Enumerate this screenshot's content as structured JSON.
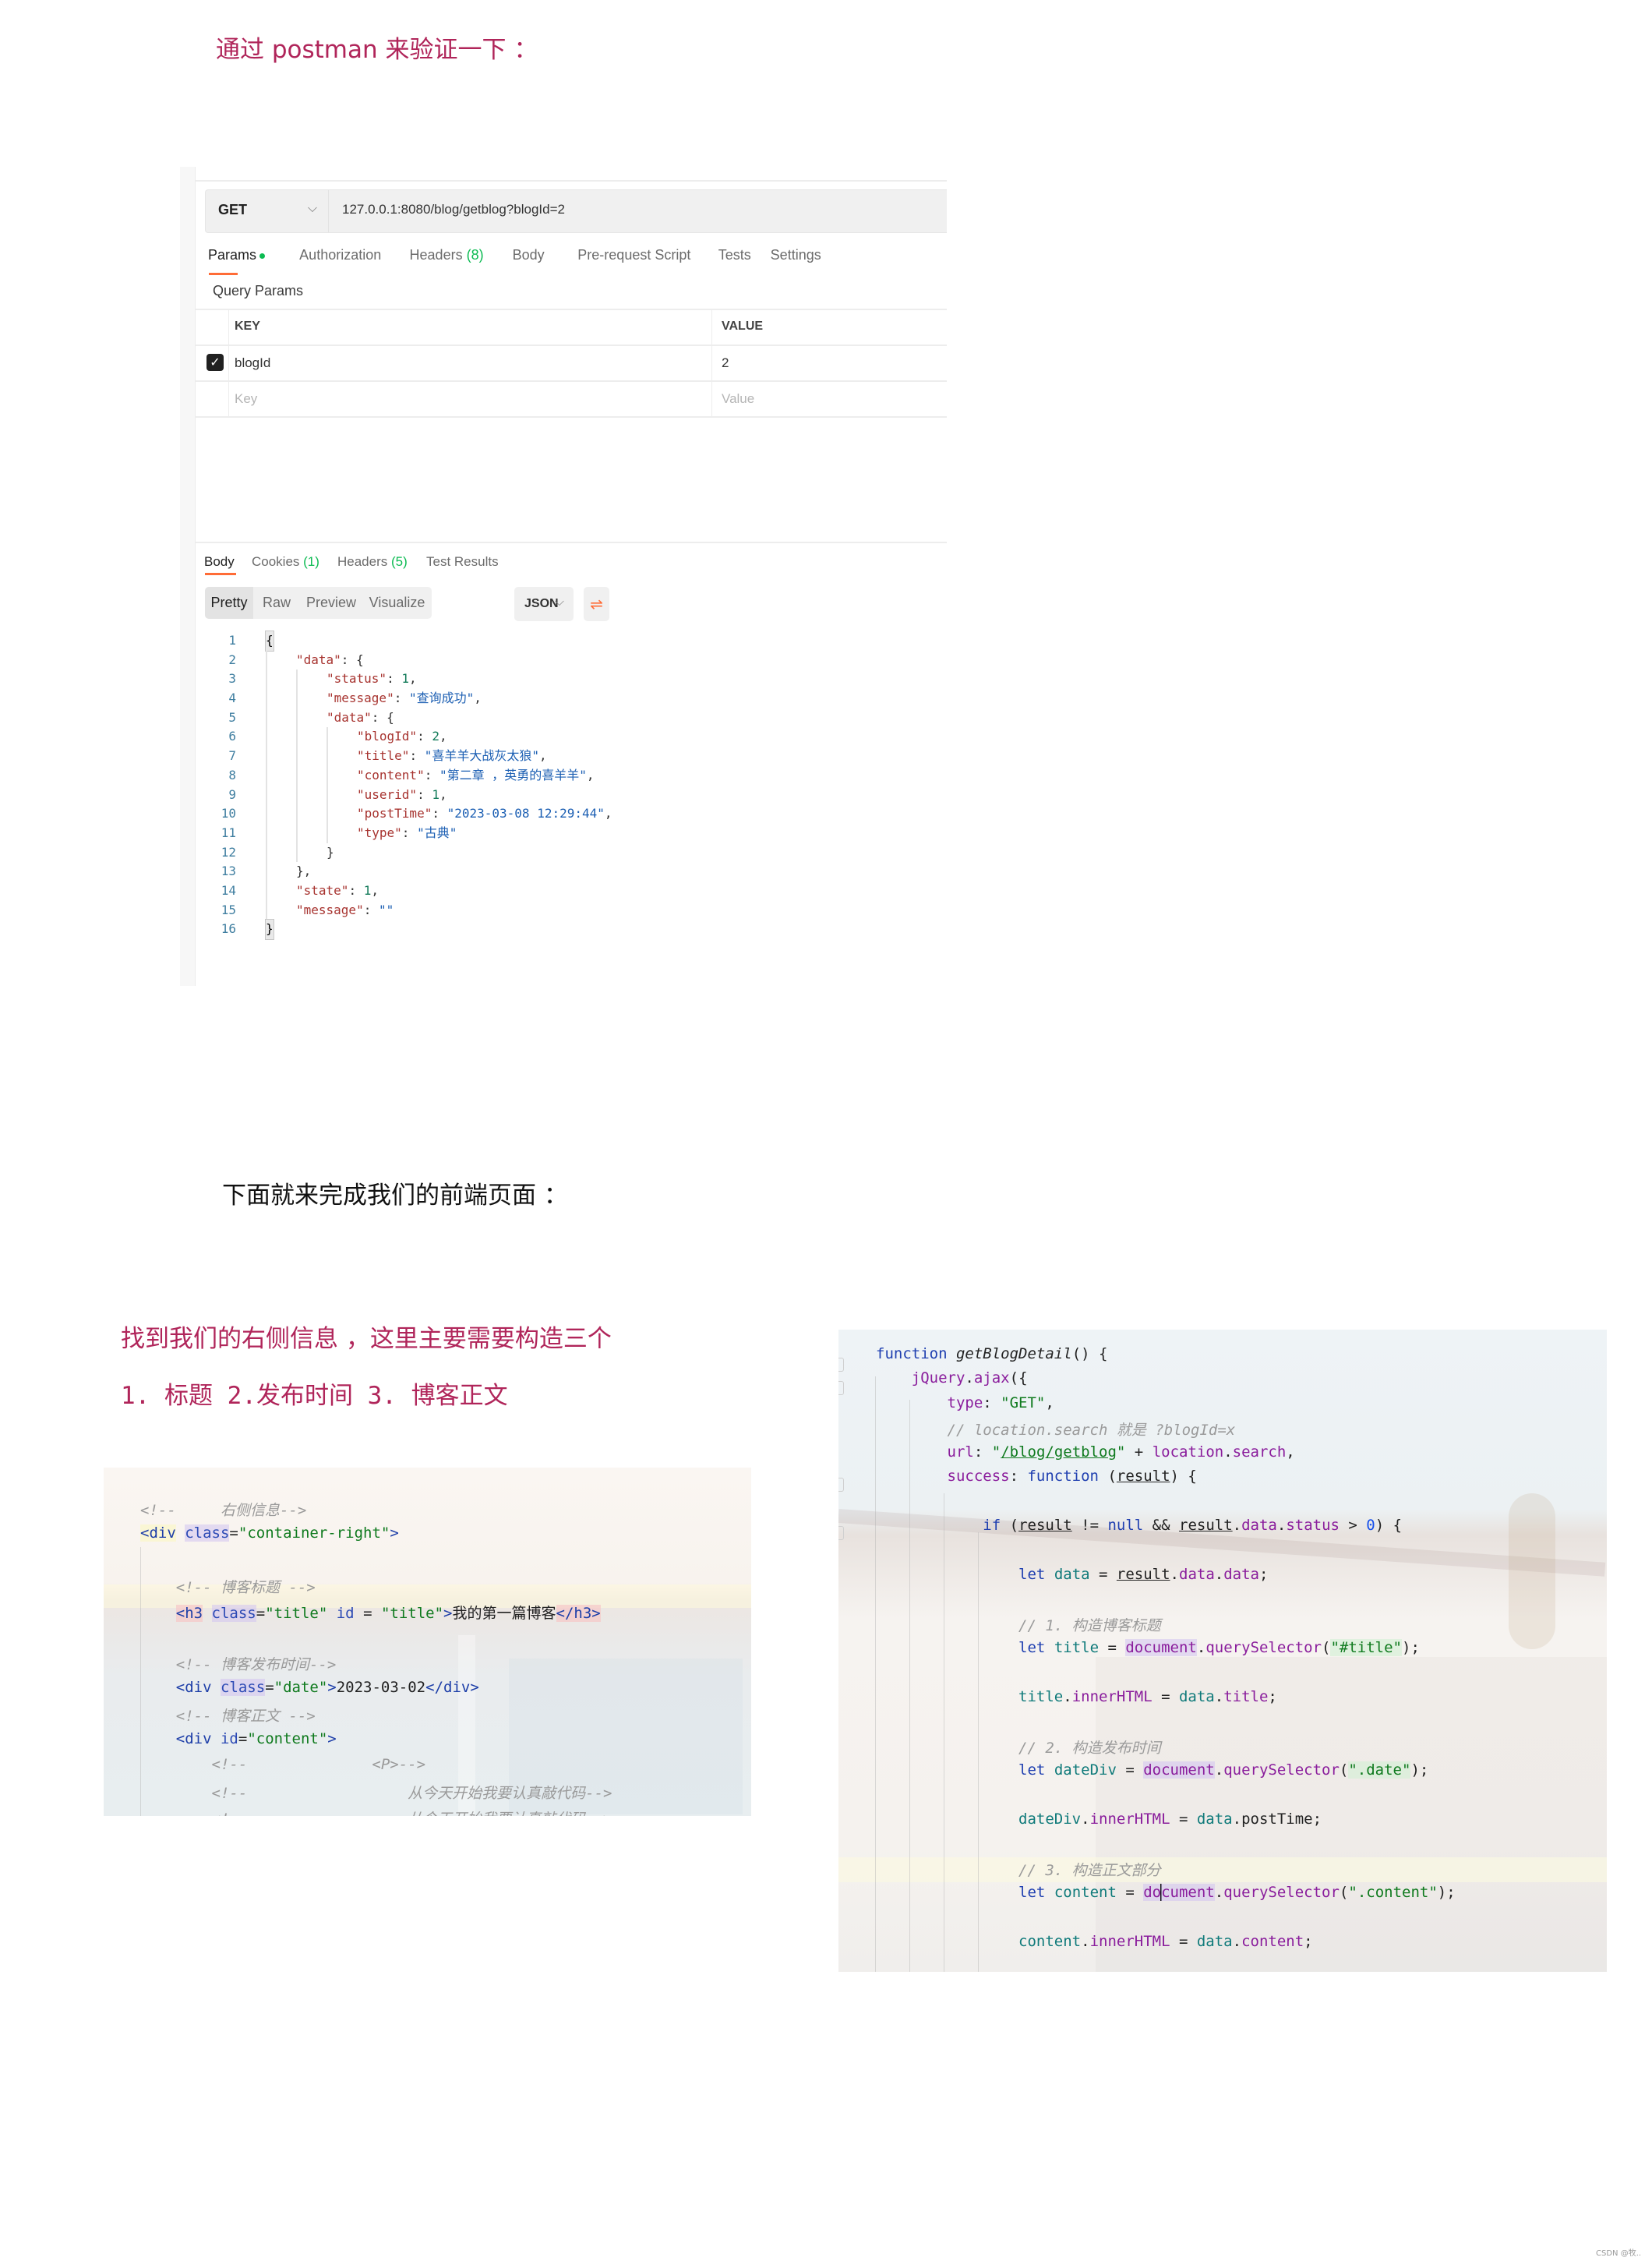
{
  "intro": {
    "verify_text": "通过 postman 来验证一下 ：",
    "frontend_text": "下面就来完成我们的前端页面 ：",
    "right_info_text": "找到我们的右侧信息 ，这里主要需要构造三个",
    "items_text": "1. 标题 2.发布时间 3. 博客正文"
  },
  "postman": {
    "method": "GET",
    "url": "127.0.0.1:8080/blog/getblog?blogId=2",
    "request_tabs": [
      {
        "label": "Params",
        "count": "",
        "active": true,
        "dot": true
      },
      {
        "label": "Authorization",
        "count": ""
      },
      {
        "label": "Headers ",
        "count": "(8)"
      },
      {
        "label": "Body",
        "count": ""
      },
      {
        "label": "Pre-request Script",
        "count": ""
      },
      {
        "label": "Tests",
        "count": ""
      },
      {
        "label": "Settings",
        "count": ""
      }
    ],
    "query_params_title": "Query Params",
    "params_table": {
      "headers": [
        "KEY",
        "VALUE"
      ],
      "rows": [
        {
          "checked": true,
          "key": "blogId",
          "value": "2"
        }
      ],
      "placeholder": {
        "key": "Key",
        "value": "Value"
      }
    },
    "response_tabs": [
      {
        "label": "Body",
        "count": "",
        "active": true
      },
      {
        "label": "Cookies ",
        "count": "(1)"
      },
      {
        "label": "Headers ",
        "count": "(5)"
      },
      {
        "label": "Test Results",
        "count": ""
      }
    ],
    "view_modes": [
      "Pretty",
      "Raw",
      "Preview",
      "Visualize"
    ],
    "active_view": "Pretty",
    "format": "JSON",
    "response_lines": [
      {
        "n": "1",
        "indent": 0,
        "parts": [
          [
            "brk",
            "{"
          ]
        ]
      },
      {
        "n": "2",
        "indent": 1,
        "parts": [
          [
            "k",
            "\"data\""
          ],
          [
            "p",
            ": {"
          ]
        ]
      },
      {
        "n": "3",
        "indent": 2,
        "parts": [
          [
            "k",
            "\"status\""
          ],
          [
            "p",
            ": "
          ],
          [
            "n",
            "1"
          ],
          [
            "p",
            ","
          ]
        ]
      },
      {
        "n": "4",
        "indent": 2,
        "parts": [
          [
            "k",
            "\"message\""
          ],
          [
            "p",
            ": "
          ],
          [
            "s",
            "\"查询成功\""
          ],
          [
            "p",
            ","
          ]
        ]
      },
      {
        "n": "5",
        "indent": 2,
        "parts": [
          [
            "k",
            "\"data\""
          ],
          [
            "p",
            ": {"
          ]
        ]
      },
      {
        "n": "6",
        "indent": 3,
        "parts": [
          [
            "k",
            "\"blogId\""
          ],
          [
            "p",
            ": "
          ],
          [
            "n",
            "2"
          ],
          [
            "p",
            ","
          ]
        ]
      },
      {
        "n": "7",
        "indent": 3,
        "parts": [
          [
            "k",
            "\"title\""
          ],
          [
            "p",
            ": "
          ],
          [
            "s",
            "\"喜羊羊大战灰太狼\""
          ],
          [
            "p",
            ","
          ]
        ]
      },
      {
        "n": "8",
        "indent": 3,
        "parts": [
          [
            "k",
            "\"content\""
          ],
          [
            "p",
            ": "
          ],
          [
            "s",
            "\"第二章 ，英勇的喜羊羊\""
          ],
          [
            "p",
            ","
          ]
        ]
      },
      {
        "n": "9",
        "indent": 3,
        "parts": [
          [
            "k",
            "\"userid\""
          ],
          [
            "p",
            ": "
          ],
          [
            "n",
            "1"
          ],
          [
            "p",
            ","
          ]
        ]
      },
      {
        "n": "10",
        "indent": 3,
        "parts": [
          [
            "k",
            "\"postTime\""
          ],
          [
            "p",
            ": "
          ],
          [
            "s",
            "\"2023-03-08 12:29:44\""
          ],
          [
            "p",
            ","
          ]
        ]
      },
      {
        "n": "11",
        "indent": 3,
        "parts": [
          [
            "k",
            "\"type\""
          ],
          [
            "p",
            ": "
          ],
          [
            "s",
            "\"古典\""
          ]
        ]
      },
      {
        "n": "12",
        "indent": 2,
        "parts": [
          [
            "p",
            "}"
          ]
        ]
      },
      {
        "n": "13",
        "indent": 1,
        "parts": [
          [
            "p",
            "},"
          ]
        ]
      },
      {
        "n": "14",
        "indent": 1,
        "parts": [
          [
            "k",
            "\"state\""
          ],
          [
            "p",
            ": "
          ],
          [
            "n",
            "1"
          ],
          [
            "p",
            ","
          ]
        ]
      },
      {
        "n": "15",
        "indent": 1,
        "parts": [
          [
            "k",
            "\"message\""
          ],
          [
            "p",
            ": "
          ],
          [
            "s",
            "\"\""
          ]
        ]
      },
      {
        "n": "16",
        "indent": 0,
        "parts": [
          [
            "brk",
            "}"
          ]
        ]
      }
    ]
  },
  "html_snippet": {
    "lines": [
      [
        [
          "t-cm",
          "<!--     右侧信息-->"
        ]
      ],
      [
        [
          "t-tag hl-yellow",
          "<div"
        ],
        [
          "t-plain",
          " "
        ],
        [
          "t-attr hl-purple",
          "class"
        ],
        [
          "t-plain",
          "="
        ],
        [
          "t-str",
          "\"container-right\""
        ],
        [
          "t-tag",
          ">"
        ]
      ],
      [],
      [
        [
          "t-cm",
          "    <!-- 博客标题 -->"
        ]
      ],
      [
        [
          "t-plain",
          "    "
        ],
        [
          "t-tag hl-red",
          "<h3"
        ],
        [
          "t-plain",
          " "
        ],
        [
          "t-attr hl-purple",
          "class"
        ],
        [
          "t-plain",
          "="
        ],
        [
          "t-str",
          "\"title\""
        ],
        [
          "t-plain",
          " "
        ],
        [
          "t-attr",
          "id"
        ],
        [
          "t-plain",
          " = "
        ],
        [
          "t-str",
          "\"title\""
        ],
        [
          "t-tag",
          ">"
        ],
        [
          "t-plain",
          "我的第一篇博客"
        ],
        [
          "t-tag hl-red",
          "</h3>"
        ]
      ],
      [],
      [
        [
          "t-cm",
          "    <!-- 博客发布时间-->"
        ]
      ],
      [
        [
          "t-plain",
          "    "
        ],
        [
          "t-tag",
          "<div"
        ],
        [
          "t-plain",
          " "
        ],
        [
          "t-attr hl-purple",
          "class"
        ],
        [
          "t-plain",
          "="
        ],
        [
          "t-str",
          "\"date\""
        ],
        [
          "t-tag",
          ">"
        ],
        [
          "t-plain",
          "2023-03-02"
        ],
        [
          "t-tag",
          "</div>"
        ]
      ],
      [
        [
          "t-cm",
          "    <!-- 博客正文 -->"
        ]
      ],
      [
        [
          "t-plain",
          "    "
        ],
        [
          "t-tag",
          "<div"
        ],
        [
          "t-plain",
          " "
        ],
        [
          "t-attr",
          "id"
        ],
        [
          "t-plain",
          "="
        ],
        [
          "t-str",
          "\"content\""
        ],
        [
          "t-tag",
          ">"
        ]
      ],
      [
        [
          "t-cm",
          "        <!--              <P>-->"
        ]
      ],
      [
        [
          "t-cm",
          "        <!--                  从今天开始我要认真敲代码-->"
        ]
      ],
      [
        [
          "t-cm",
          "        <!--                  从今天开始我要认真敲代码-->"
        ]
      ]
    ]
  },
  "js_snippet": {
    "lines": [
      [
        [
          "t-kw",
          "function"
        ],
        [
          "t-plain",
          " "
        ],
        [
          "t-fn",
          "getBlogDetail"
        ],
        [
          "t-plain",
          "() {"
        ]
      ],
      [
        [
          "t-plain",
          "    "
        ],
        [
          "t-mem",
          "jQuery"
        ],
        [
          "t-plain",
          "."
        ],
        [
          "t-mem",
          "ajax"
        ],
        [
          "t-plain",
          "({"
        ]
      ],
      [
        [
          "t-plain",
          "        "
        ],
        [
          "t-mem",
          "type"
        ],
        [
          "t-plain",
          ": "
        ],
        [
          "t-str",
          "\"GET\""
        ],
        [
          "t-plain",
          ","
        ]
      ],
      [
        [
          "t-plain",
          "        "
        ],
        [
          "t-cm",
          "// location.search 就是 ?blogId=x"
        ]
      ],
      [
        [
          "t-plain",
          "        "
        ],
        [
          "t-mem",
          "url"
        ],
        [
          "t-plain",
          ": "
        ],
        [
          "t-str",
          "\""
        ],
        [
          "t-str t-ul",
          "/blog/getblog"
        ],
        [
          "t-str",
          "\""
        ],
        [
          "t-plain",
          " + "
        ],
        [
          "t-mem",
          "location"
        ],
        [
          "t-plain",
          "."
        ],
        [
          "t-mem",
          "search"
        ],
        [
          "t-plain",
          ","
        ]
      ],
      [
        [
          "t-plain",
          "        "
        ],
        [
          "t-mem",
          "success"
        ],
        [
          "t-plain",
          ": "
        ],
        [
          "t-kw",
          "function"
        ],
        [
          "t-plain",
          " ("
        ],
        [
          "t-plain t-ul",
          "result"
        ],
        [
          "t-plain",
          ") {"
        ]
      ],
      [],
      [
        [
          "t-plain",
          "            "
        ],
        [
          "t-kw",
          "if"
        ],
        [
          "t-plain",
          " ("
        ],
        [
          "t-plain t-ul",
          "result"
        ],
        [
          "t-plain",
          " != "
        ],
        [
          "t-kw",
          "null"
        ],
        [
          "t-plain",
          " && "
        ],
        [
          "t-plain t-ul",
          "result"
        ],
        [
          "t-plain",
          "."
        ],
        [
          "t-mem",
          "data"
        ],
        [
          "t-plain",
          "."
        ],
        [
          "t-mem",
          "status"
        ],
        [
          "t-plain",
          " > "
        ],
        [
          "t-num",
          "0"
        ],
        [
          "t-plain",
          ") {"
        ]
      ],
      [],
      [
        [
          "t-plain",
          "                "
        ],
        [
          "t-kw",
          "let"
        ],
        [
          "t-plain",
          " "
        ],
        [
          "t-var",
          "data"
        ],
        [
          "t-plain",
          " = "
        ],
        [
          "t-plain t-ul",
          "result"
        ],
        [
          "t-plain",
          "."
        ],
        [
          "t-mem",
          "data"
        ],
        [
          "t-plain",
          "."
        ],
        [
          "t-mem",
          "data"
        ],
        [
          "t-plain",
          ";"
        ]
      ],
      [],
      [
        [
          "t-plain",
          "                "
        ],
        [
          "t-cm",
          "// 1. 构造博客标题"
        ]
      ],
      [
        [
          "t-plain",
          "                "
        ],
        [
          "t-kw",
          "let"
        ],
        [
          "t-plain",
          " "
        ],
        [
          "t-var",
          "title"
        ],
        [
          "t-plain",
          " = "
        ],
        [
          "t-mem hl-purple",
          "document"
        ],
        [
          "t-plain",
          "."
        ],
        [
          "t-mem",
          "querySelector"
        ],
        [
          "t-plain",
          "("
        ],
        [
          "t-str hl-green",
          "\"#title\""
        ],
        [
          "t-plain",
          ");"
        ]
      ],
      [],
      [
        [
          "t-plain",
          "                "
        ],
        [
          "t-var",
          "title"
        ],
        [
          "t-plain",
          "."
        ],
        [
          "t-mem",
          "innerHTML"
        ],
        [
          "t-plain",
          " = "
        ],
        [
          "t-var",
          "data"
        ],
        [
          "t-plain",
          "."
        ],
        [
          "t-mem",
          "title"
        ],
        [
          "t-plain",
          ";"
        ]
      ],
      [],
      [
        [
          "t-plain",
          "                "
        ],
        [
          "t-cm",
          "// 2. 构造发布时间"
        ]
      ],
      [
        [
          "t-plain",
          "                "
        ],
        [
          "t-kw",
          "let"
        ],
        [
          "t-plain",
          " "
        ],
        [
          "t-var",
          "dateDiv"
        ],
        [
          "t-plain",
          " = "
        ],
        [
          "t-mem hl-purple",
          "document"
        ],
        [
          "t-plain",
          "."
        ],
        [
          "t-mem",
          "querySelector"
        ],
        [
          "t-plain",
          "("
        ],
        [
          "t-str hl-green",
          "\".date\""
        ],
        [
          "t-plain",
          ");"
        ]
      ],
      [],
      [
        [
          "t-plain",
          "                "
        ],
        [
          "t-var",
          "dateDiv"
        ],
        [
          "t-plain",
          "."
        ],
        [
          "t-mem",
          "innerHTML"
        ],
        [
          "t-plain",
          " = "
        ],
        [
          "t-var",
          "data"
        ],
        [
          "t-plain",
          "."
        ],
        [
          "t-plain",
          "postTime"
        ],
        [
          "t-plain",
          ";"
        ]
      ],
      [],
      [
        [
          "t-plain",
          "                "
        ],
        [
          "t-cm",
          "// 3. 构造正文部分"
        ]
      ],
      [
        [
          "t-plain",
          "                "
        ],
        [
          "t-kw",
          "let"
        ],
        [
          "t-plain",
          " "
        ],
        [
          "t-var",
          "content"
        ],
        [
          "t-plain",
          " = "
        ],
        [
          "t-mem hl-purple",
          "do"
        ],
        [
          "caret",
          ""
        ],
        [
          "t-mem hl-purple",
          "cument"
        ],
        [
          "t-plain",
          "."
        ],
        [
          "t-mem",
          "querySelector"
        ],
        [
          "t-plain",
          "("
        ],
        [
          "t-str",
          "\".content\""
        ],
        [
          "t-plain",
          ");"
        ]
      ],
      [],
      [
        [
          "t-plain",
          "                "
        ],
        [
          "t-var",
          "content"
        ],
        [
          "t-plain",
          "."
        ],
        [
          "t-mem",
          "innerHTML"
        ],
        [
          "t-plain",
          " = "
        ],
        [
          "t-var",
          "data"
        ],
        [
          "t-plain",
          "."
        ],
        [
          "t-mem",
          "content"
        ],
        [
          "t-plain",
          ";"
        ]
      ]
    ]
  },
  "watermark": "CSDN @牧.."
}
